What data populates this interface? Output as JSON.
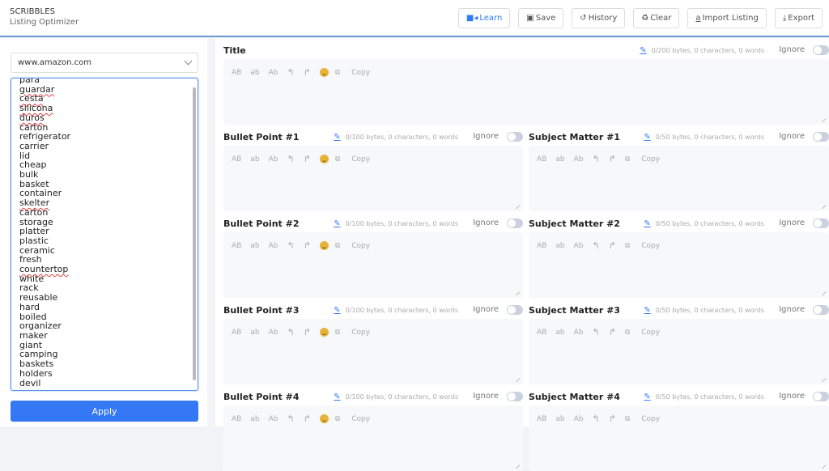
{
  "header": {
    "brand": "SCRIBBLES",
    "subtitle": "Listing Optimizer",
    "toolbar": [
      {
        "label": "Learn",
        "icon": "video-icon",
        "glyph": "■◂",
        "accent": "#2f7cf6"
      },
      {
        "label": "Save",
        "icon": "save-icon",
        "glyph": "▣"
      },
      {
        "label": "History",
        "icon": "history-icon",
        "glyph": "↺"
      },
      {
        "label": "Clear",
        "icon": "recycle-icon",
        "glyph": "♻"
      },
      {
        "label": "Import Listing",
        "icon": "amazon-icon",
        "glyph": "a"
      },
      {
        "label": "Export",
        "icon": "download-icon",
        "glyph": "⤓"
      }
    ]
  },
  "sidebar": {
    "marketplace": "www.amazon.com",
    "keywords": [
      {
        "text": "para",
        "spell": false
      },
      {
        "text": "guardar",
        "spell": true
      },
      {
        "text": "cesta",
        "spell": true
      },
      {
        "text": "silicona",
        "spell": true
      },
      {
        "text": "duros",
        "spell": true
      },
      {
        "text": "carton",
        "spell": false
      },
      {
        "text": "refrigerator",
        "spell": false
      },
      {
        "text": "carrier",
        "spell": false
      },
      {
        "text": "lid",
        "spell": false
      },
      {
        "text": "cheap",
        "spell": false
      },
      {
        "text": "bulk",
        "spell": false
      },
      {
        "text": "basket",
        "spell": false
      },
      {
        "text": "container",
        "spell": false
      },
      {
        "text": "skelter",
        "spell": true
      },
      {
        "text": "carton",
        "spell": false
      },
      {
        "text": "storage",
        "spell": false
      },
      {
        "text": "platter",
        "spell": false
      },
      {
        "text": "plastic",
        "spell": false
      },
      {
        "text": "ceramic",
        "spell": false
      },
      {
        "text": "fresh",
        "spell": false
      },
      {
        "text": "countertop",
        "spell": true
      },
      {
        "text": "white",
        "spell": false
      },
      {
        "text": "rack",
        "spell": false
      },
      {
        "text": "reusable",
        "spell": false
      },
      {
        "text": "hard",
        "spell": false
      },
      {
        "text": "boiled",
        "spell": false
      },
      {
        "text": "organizer",
        "spell": false
      },
      {
        "text": "maker",
        "spell": false
      },
      {
        "text": "giant",
        "spell": false
      },
      {
        "text": "camping",
        "spell": false
      },
      {
        "text": "baskets",
        "spell": false
      },
      {
        "text": "holders",
        "spell": false
      },
      {
        "text": "devil",
        "spell": false
      }
    ],
    "apply_label": "Apply"
  },
  "editor_tools": {
    "upper": "AB",
    "lower": "ab",
    "title": "Ab",
    "copy": "Copy",
    "ignore": "Ignore"
  },
  "fields": {
    "title": {
      "label": "Title",
      "stats": "0/200 bytes, 0 characters, 0 words",
      "ignored": false
    },
    "bullets": [
      {
        "label": "Bullet Point #1",
        "stats": "0/100 bytes, 0 characters, 0 words",
        "ignored": false
      },
      {
        "label": "Bullet Point #2",
        "stats": "0/100 bytes, 0 characters, 0 words",
        "ignored": false
      },
      {
        "label": "Bullet Point #3",
        "stats": "0/100 bytes, 0 characters, 0 words",
        "ignored": false
      },
      {
        "label": "Bullet Point #4",
        "stats": "0/100 bytes, 0 characters, 0 words",
        "ignored": false
      }
    ],
    "subjects": [
      {
        "label": "Subject Matter #1",
        "stats": "0/50 bytes, 0 characters, 0 words",
        "ignored": false
      },
      {
        "label": "Subject Matter #2",
        "stats": "0/50 bytes, 0 characters, 0 words",
        "ignored": false
      },
      {
        "label": "Subject Matter #3",
        "stats": "0/50 bytes, 0 characters, 0 words",
        "ignored": false
      },
      {
        "label": "Subject Matter #4",
        "stats": "0/50 bytes, 0 characters, 0 words",
        "ignored": false
      }
    ]
  }
}
